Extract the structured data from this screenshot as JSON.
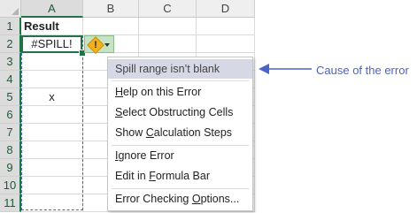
{
  "columns": [
    "A",
    "B",
    "C",
    "D"
  ],
  "rows": [
    "1",
    "2",
    "3",
    "4",
    "5",
    "6",
    "7",
    "8",
    "9",
    "10",
    "11"
  ],
  "cells": {
    "A1": "Result",
    "A2": "#SPILL!",
    "A5": "x"
  },
  "error_menu": {
    "items": [
      {
        "text": "Spill range isn’t blank"
      },
      {
        "pre": "",
        "u": "H",
        "post": "elp on this Error"
      },
      {
        "pre": "",
        "u": "S",
        "post": "elect Obstructing Cells"
      },
      {
        "pre": "Show ",
        "u": "C",
        "post": "alculation Steps"
      },
      {
        "pre": "",
        "u": "I",
        "post": "gnore Error"
      },
      {
        "pre": "Edit in ",
        "u": "F",
        "post": "ormula Bar"
      },
      {
        "pre": "Error Checking ",
        "u": "O",
        "post": "ptions..."
      }
    ]
  },
  "annotation": {
    "text": "Cause of the error",
    "color": "#4a64c8"
  },
  "colors": {
    "accent": "#217346",
    "spill_border": "#3d6fb5",
    "highlight": "#d6d9e5",
    "warning": "#f2b01e"
  }
}
